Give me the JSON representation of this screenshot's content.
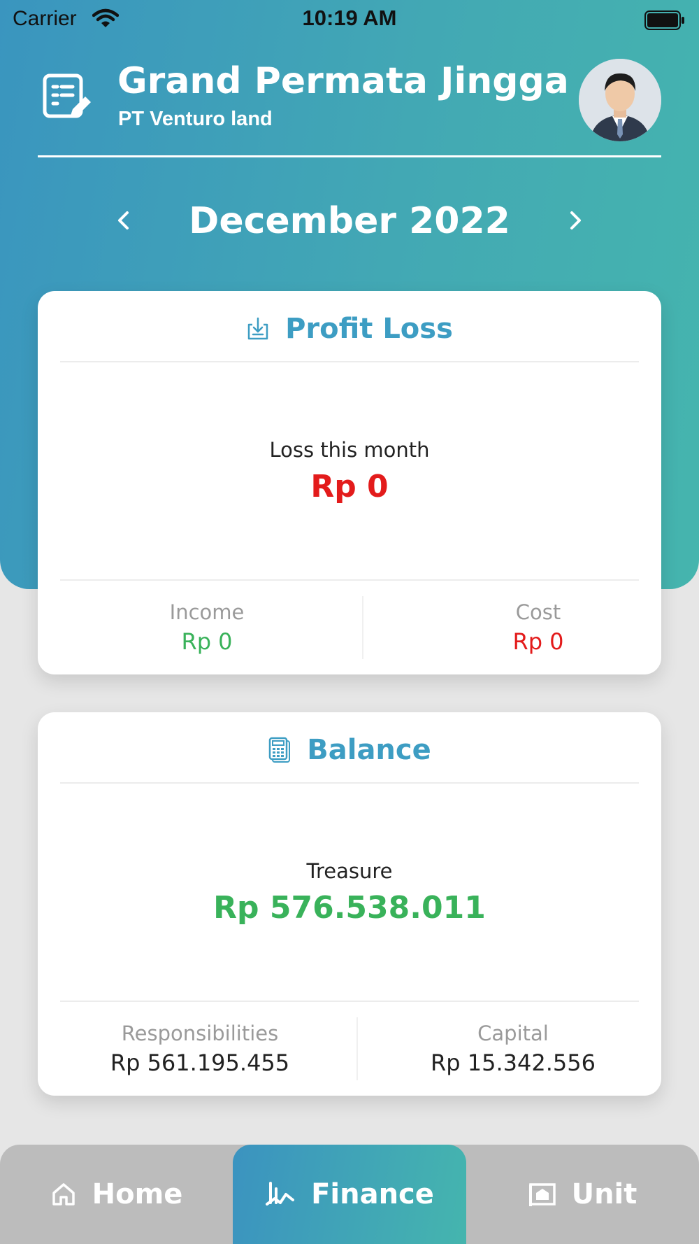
{
  "status_bar": {
    "carrier": "Carrier",
    "time": "10:19 AM"
  },
  "header": {
    "title": "Grand Permata Jingga",
    "subtitle": "PT Venturo land",
    "month": "December 2022"
  },
  "profit_loss": {
    "title": "Profit Loss",
    "main_label": "Loss this month",
    "main_value": "Rp 0",
    "income_label": "Income",
    "income_value": "Rp 0",
    "cost_label": "Cost",
    "cost_value": "Rp 0"
  },
  "balance": {
    "title": "Balance",
    "main_label": "Treasure",
    "main_value": "Rp 576.538.011",
    "responsibilities_label": "Responsibilities",
    "responsibilities_value": "Rp 561.195.455",
    "capital_label": "Capital",
    "capital_value": "Rp 15.342.556"
  },
  "nav": {
    "home": "Home",
    "finance": "Finance",
    "unit": "Unit",
    "active": "Finance"
  },
  "colors": {
    "accent": "#3d9dc3",
    "gradient_start": "#3a95bf",
    "gradient_end": "#45b5ae",
    "negative": "#e31b1b",
    "positive": "#39b25a"
  },
  "icons": {
    "app": "document-edit-icon",
    "profit_loss": "download-tray-icon",
    "balance": "calculator-icon",
    "home": "home-icon",
    "finance": "chart-trend-icon",
    "unit": "building-icon"
  }
}
